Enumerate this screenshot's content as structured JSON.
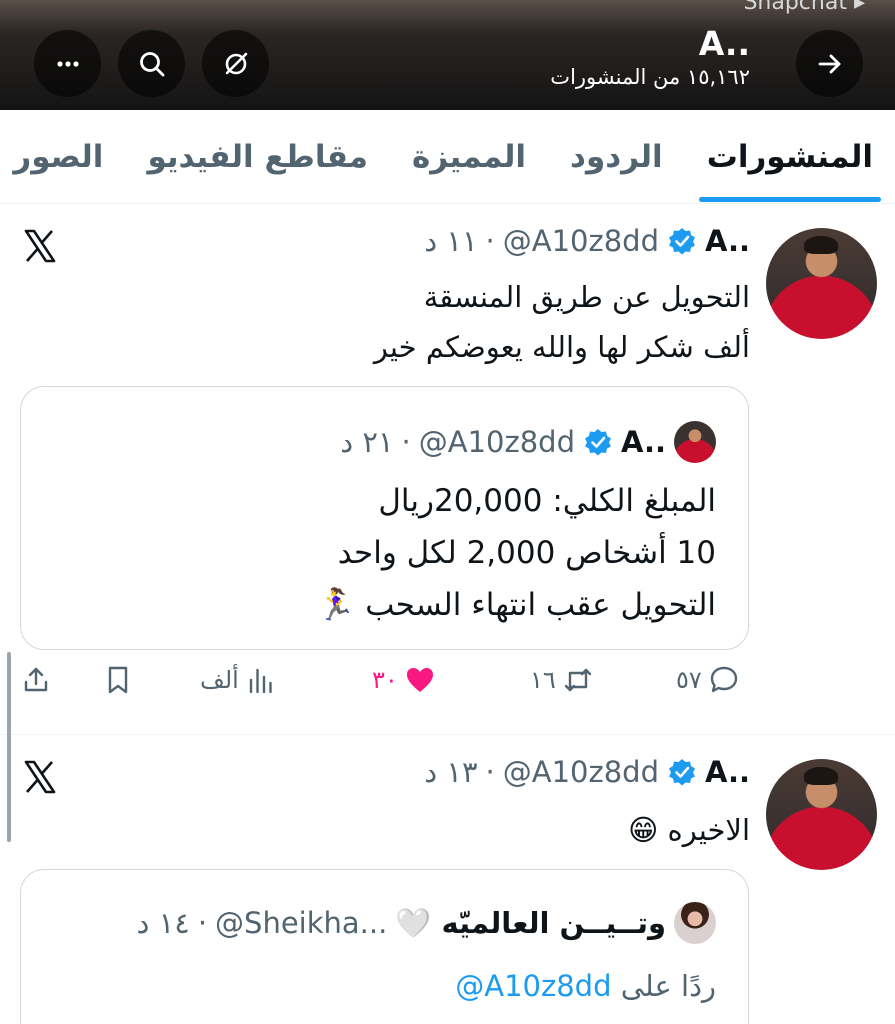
{
  "status": {
    "snap_label": "Snapchat ▸"
  },
  "header": {
    "title": "A..",
    "post_count": "١٥,١٦٢ من المنشورات",
    "back_icon": "arrow-right-icon",
    "grok_icon": "grok-icon",
    "search_icon": "search-icon",
    "more_icon": "more-icon"
  },
  "tabs": [
    {
      "label": "المنشورات",
      "active": true
    },
    {
      "label": "الردود"
    },
    {
      "label": "المميزة"
    },
    {
      "label": "مقاطع الفيديو"
    },
    {
      "label": "الصور"
    }
  ],
  "tweets": [
    {
      "name": "A..",
      "handle": "@A10z8dd",
      "sep": "·",
      "time": "١١ د",
      "lines": [
        "التحويل عن طريق المنسقة",
        "ألف شكر لها والله يعوضكم خير"
      ],
      "quote": {
        "name": "A..",
        "handle": "@A10z8dd",
        "sep": "·",
        "time": "٢١ د",
        "lines": [
          "المبلغ الكلي: 20,000ريال",
          "10 أشخاص 2,000 لكل واحد",
          "التحويل عقب انتهاء السحب 🏃‍♀️"
        ]
      },
      "actions": {
        "replies": "٥٧",
        "reposts": "١٦",
        "likes": "٣٠",
        "views": "ألف"
      }
    },
    {
      "name": "A..",
      "handle": "@A10z8dd",
      "sep": "·",
      "time": "١٣ د",
      "lines": [
        "الاخيره 😁"
      ],
      "quote": {
        "name": "وتــيــن العالميّه 🤍",
        "handle": "@Sheikha...",
        "sep": "·",
        "time": "١٤ د",
        "reply_prefix": "ردًا على",
        "reply_to": "@A10z8dd"
      }
    }
  ],
  "colors": {
    "accent": "#1d9bf0",
    "like": "#f91880",
    "muted": "#536471"
  }
}
